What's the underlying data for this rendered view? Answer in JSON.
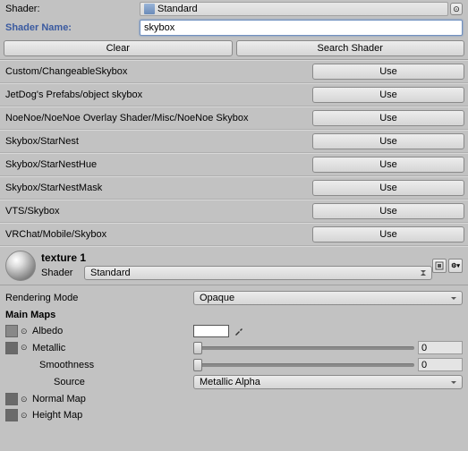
{
  "header": {
    "shader_label": "Shader:",
    "shader_value": "Standard",
    "shadername_label": "Shader Name:",
    "search_value": "skybox"
  },
  "topButtons": {
    "clear": "Clear",
    "search": "Search Shader"
  },
  "results": [
    "Custom/ChangeableSkybox",
    "JetDog's Prefabs/object skybox",
    "NoeNoe/NoeNoe Overlay Shader/Misc/NoeNoe Skybox",
    "Skybox/StarNest",
    "Skybox/StarNestHue",
    "Skybox/StarNestMask",
    "VTS/Skybox",
    "VRChat/Mobile/Skybox"
  ],
  "useLabel": "Use",
  "material": {
    "name": "texture 1",
    "shader_label": "Shader",
    "shader_value": "Standard"
  },
  "props": {
    "renderingMode_label": "Rendering Mode",
    "renderingMode_value": "Opaque",
    "mainMaps": "Main Maps",
    "albedo": "Albedo",
    "metallic": "Metallic",
    "metallic_value": "0",
    "smoothness": "Smoothness",
    "smoothness_value": "0",
    "source": "Source",
    "source_value": "Metallic Alpha",
    "normalMap": "Normal Map",
    "heightMap": "Height Map"
  }
}
